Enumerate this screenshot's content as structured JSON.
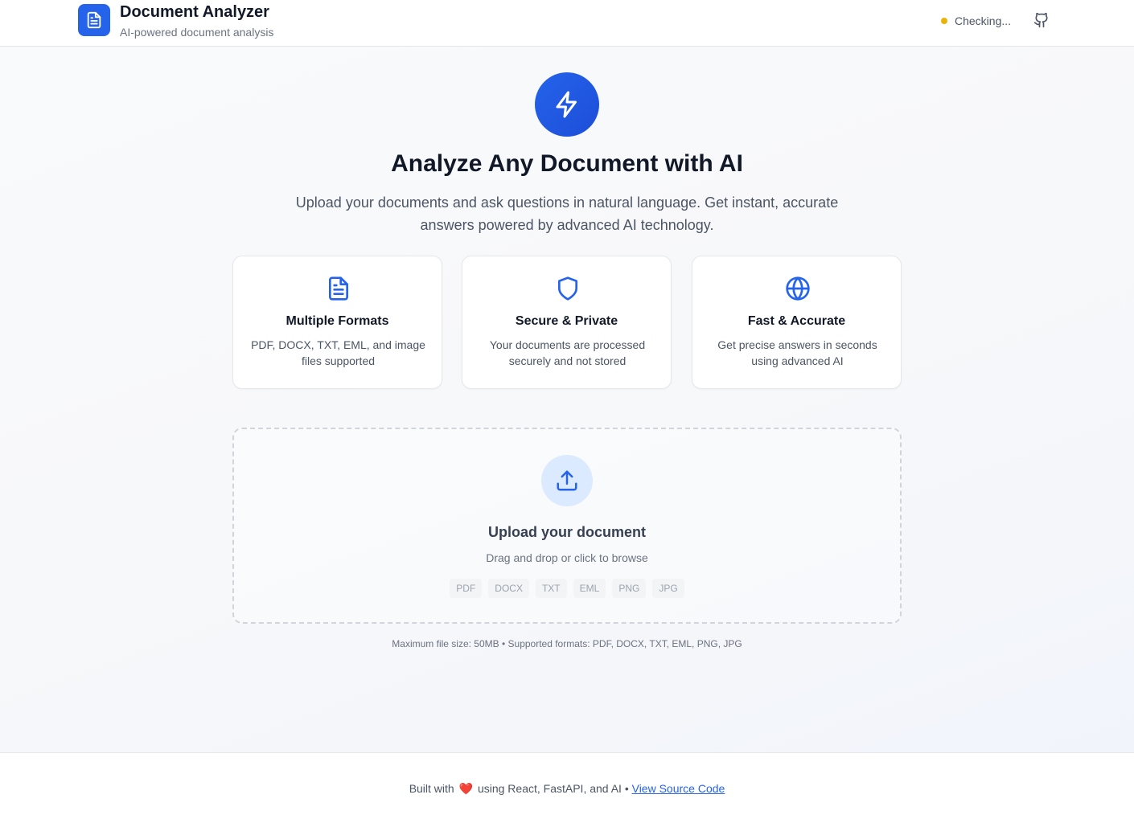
{
  "header": {
    "title": "Document Analyzer",
    "subtitle": "AI-powered document analysis",
    "status_text": "Checking...",
    "status_color": "#eab308",
    "logo_icon": "document-icon",
    "repo_icon": "github-icon"
  },
  "hero": {
    "icon": "lightning-icon",
    "title": "Analyze Any Document with AI",
    "description": "Upload your documents and ask questions in natural language. Get instant, accurate answers powered by advanced AI technology."
  },
  "features": [
    {
      "icon": "document-icon",
      "title": "Multiple Formats",
      "description": "PDF, DOCX, TXT, EML, and image files supported"
    },
    {
      "icon": "shield-icon",
      "title": "Secure & Private",
      "description": "Your documents are processed securely and not stored"
    },
    {
      "icon": "globe-icon",
      "title": "Fast & Accurate",
      "description": "Get precise answers in seconds using advanced AI"
    }
  ],
  "upload": {
    "icon": "upload-icon",
    "title": "Upload your document",
    "hint": "Drag and drop or click to browse",
    "formats": [
      "PDF",
      "DOCX",
      "TXT",
      "EML",
      "PNG",
      "JPG"
    ],
    "limits": "Maximum file size: 50MB • Supported formats: PDF, DOCX, TXT, EML, PNG, JPG"
  },
  "footer": {
    "prefix": "Built with",
    "heart": "❤️",
    "suffix": "using React, FastAPI, and AI •",
    "link_label": "View Source Code"
  },
  "colors": {
    "accent": "#2563eb",
    "text": "#111827",
    "muted": "#6b7280"
  }
}
